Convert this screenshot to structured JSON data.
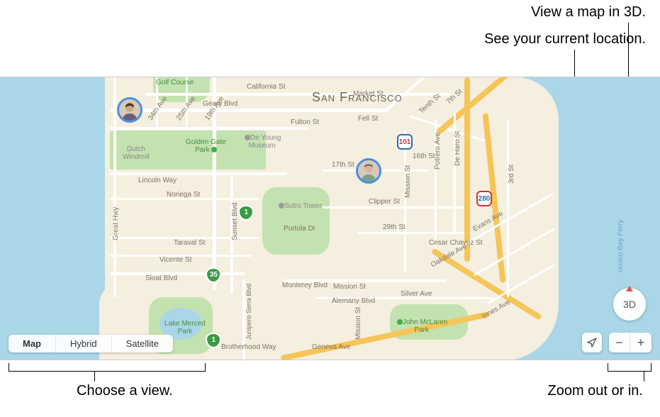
{
  "annotations": {
    "view_3d": "View a map in 3D.",
    "current_location": "See your current location.",
    "choose_view": "Choose a view.",
    "zoom": "Zoom out or in."
  },
  "city_title": "San Francisco",
  "view_modes": {
    "map": "Map",
    "hybrid": "Hybrid",
    "satellite": "Satellite",
    "active": "map"
  },
  "compass": {
    "label": "3D"
  },
  "zoom_controls": {
    "out": "−",
    "in": "+"
  },
  "shields": {
    "us101": "101",
    "i280": "280",
    "ca1_a": "1",
    "ca1_b": "1",
    "ca35": "35"
  },
  "roads": {
    "california": "California St",
    "geary": "Geary Blvd",
    "fulton": "Fulton St",
    "lincoln": "Lincoln Way",
    "noriega": "Noriega St",
    "taraval": "Taraval St",
    "vicente": "Vicente St",
    "sloat": "Sloat Blvd",
    "brotherhood": "Brotherhood Way",
    "portola": "Portola Dr",
    "monterey": "Monterey Blvd",
    "mission_blvd": "Mission St",
    "alemany": "Alemany Blvd",
    "silver": "Silver Ave",
    "geneva": "Geneva Ave",
    "evans": "Evans Ave",
    "innes": "Innes Ave",
    "oakdale": "Oakdale Ave",
    "tenth": "Tenth St",
    "seventh": "7th St",
    "fell": "Fell St",
    "seventeenth": "17th St",
    "sixteenth": "16th St",
    "clipper": "Clipper St",
    "twentyninth": "29th St",
    "market": "Market St",
    "av_34": "34th Ave",
    "av_25": "25th Ave",
    "av_19": "19th Ave",
    "sunset": "Sunset Blvd",
    "junipero": "Junipero Serra Blvd",
    "great_hwy": "Great Hwy",
    "mission_st": "Mission St",
    "mission_st2": "Mission St",
    "potrero": "Potrero Ave",
    "deharo": "De Haro St",
    "third": "3rd St",
    "bay_ferry": "ncisco Bay Ferry",
    "cesar_chavez": "Cesar Chavez St"
  },
  "pois": {
    "golden_gate_park": "Golden Gate\nPark",
    "de_young": "De Young\nMuseum",
    "dutch_windmill": "Dutch\nWindmill",
    "golf_course": "Golf Course",
    "sutro_tower": "Sutro Tower",
    "lake_merced": "Lake Merced\nPark",
    "john_mclaren": "John McLaren\nPark"
  }
}
